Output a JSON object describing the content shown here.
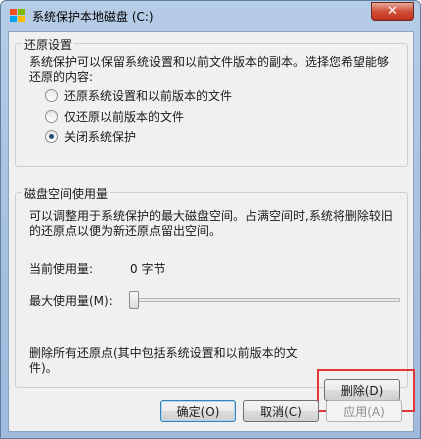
{
  "window": {
    "title": "系统保护本地磁盘 (C:)",
    "close_label": "✕"
  },
  "restore": {
    "group_title": "还原设置",
    "description": "系统保护可以保留系统设置和以前文件版本的副本。选择您希望能够还原的内容:",
    "options": [
      {
        "label": "还原系统设置和以前版本的文件",
        "checked": false
      },
      {
        "label": "仅还原以前版本的文件",
        "checked": false
      },
      {
        "label": "关闭系统保护",
        "checked": true
      }
    ]
  },
  "disk": {
    "group_title": "磁盘空间使用量",
    "description": "可以调整用于系统保护的最大磁盘空间。占满空间时,系统将删除较旧的还原点以便为新还原点留出空间。",
    "current_usage_label": "当前使用量:",
    "current_usage_value": "0 字节",
    "max_usage_label": "最大使用量(M):",
    "max_usage_slider_fraction": 0.0,
    "delete_text": "删除所有还原点(其中包括系统设置和以前版本的文件)。",
    "delete_button": "删除(D)"
  },
  "footer": {
    "ok": "确定(O)",
    "cancel": "取消(C)",
    "apply": "应用(A)"
  },
  "colors": {
    "highlight": "#e3363a",
    "title_bar": "#a9c3e1"
  }
}
